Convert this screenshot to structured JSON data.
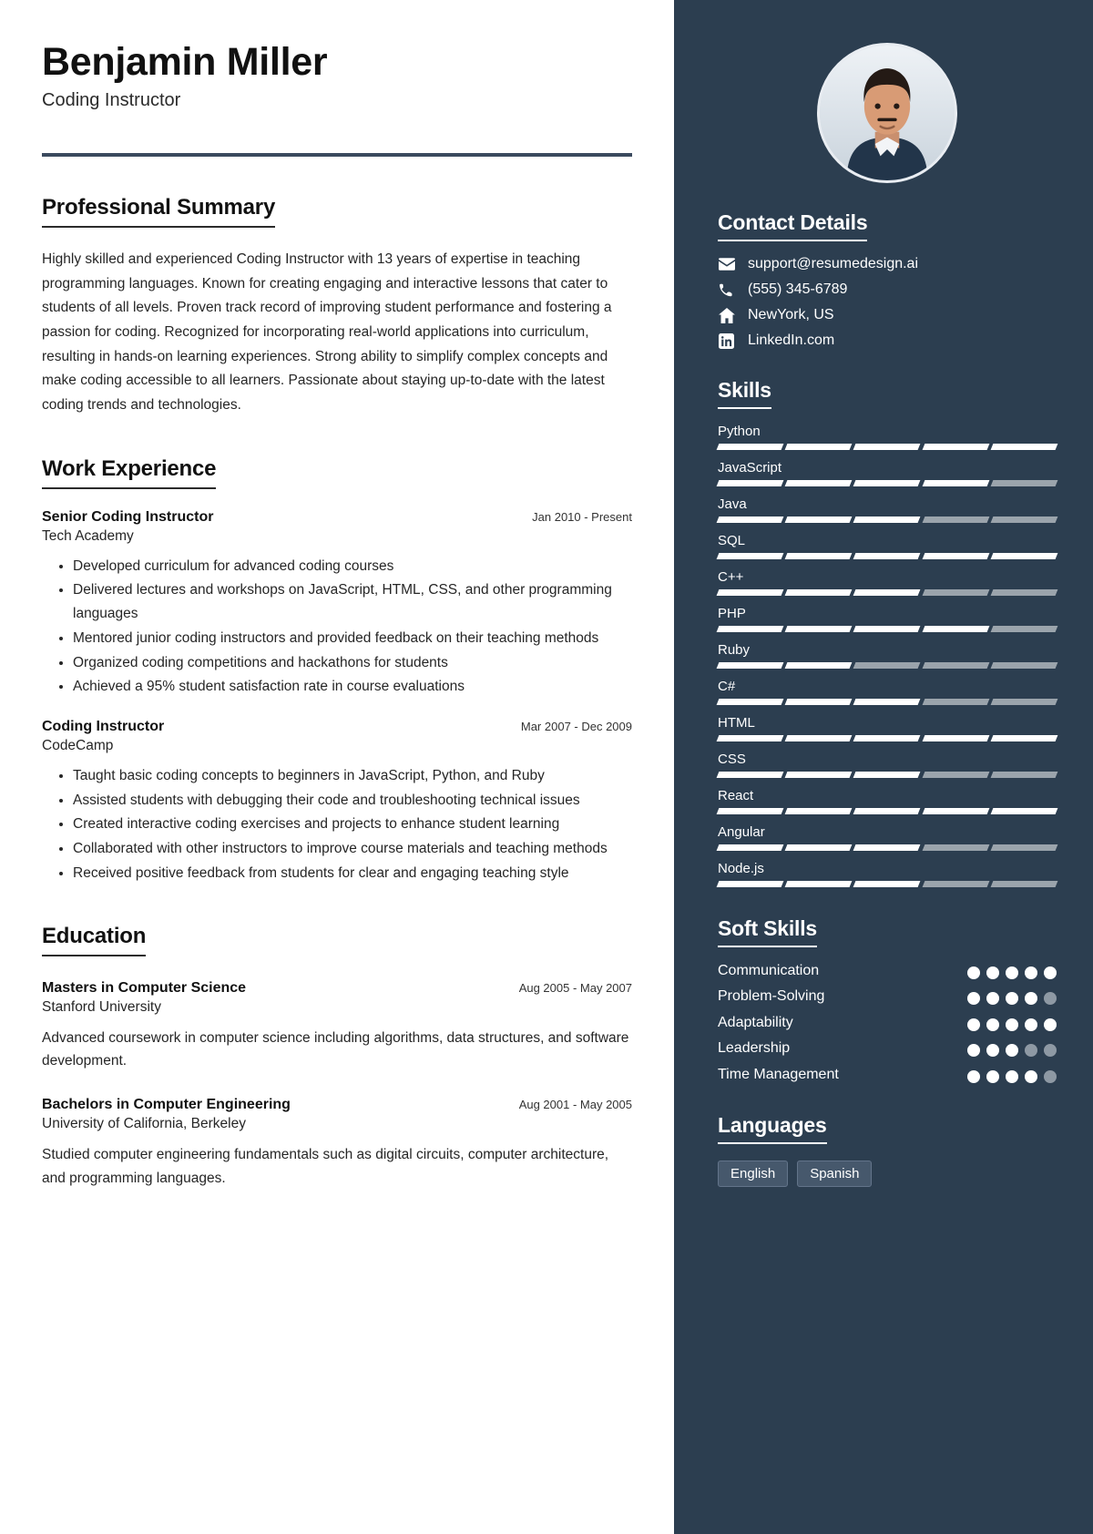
{
  "header": {
    "name": "Benjamin Miller",
    "job_title": "Coding Instructor"
  },
  "summary": {
    "title": "Professional Summary",
    "text": "Highly skilled and experienced Coding Instructor with 13 years of expertise in teaching programming languages. Known for creating engaging and interactive lessons that cater to students of all levels. Proven track record of improving student performance and fostering a passion for coding. Recognized for incorporating real-world applications into curriculum, resulting in hands-on learning experiences. Strong ability to simplify complex concepts and make coding accessible to all learners. Passionate about staying up-to-date with the latest coding trends and technologies."
  },
  "work": {
    "title": "Work Experience",
    "entries": [
      {
        "role": "Senior Coding Instructor",
        "date": "Jan 2010 - Present",
        "org": "Tech Academy",
        "bullets": [
          "Developed curriculum for advanced coding courses",
          "Delivered lectures and workshops on JavaScript, HTML, CSS, and other programming languages",
          "Mentored junior coding instructors and provided feedback on their teaching methods",
          "Organized coding competitions and hackathons for students",
          "Achieved a 95% student satisfaction rate in course evaluations"
        ]
      },
      {
        "role": "Coding Instructor",
        "date": "Mar 2007 - Dec 2009",
        "org": "CodeCamp",
        "bullets": [
          "Taught basic coding concepts to beginners in JavaScript, Python, and Ruby",
          "Assisted students with debugging their code and troubleshooting technical issues",
          "Created interactive coding exercises and projects to enhance student learning",
          "Collaborated with other instructors to improve course materials and teaching methods",
          "Received positive feedback from students for clear and engaging teaching style"
        ]
      }
    ]
  },
  "education": {
    "title": "Education",
    "entries": [
      {
        "degree": "Masters in Computer Science",
        "date": "Aug 2005 - May 2007",
        "school": "Stanford University",
        "description": "Advanced coursework in computer science including algorithms, data structures, and software development."
      },
      {
        "degree": "Bachelors in Computer Engineering",
        "date": "Aug 2001 - May 2005",
        "school": "University of California, Berkeley",
        "description": "Studied computer engineering fundamentals such as digital circuits, computer architecture, and programming languages."
      }
    ]
  },
  "contact": {
    "title": "Contact Details",
    "items": [
      {
        "icon": "envelope-icon",
        "value": "support@resumedesign.ai"
      },
      {
        "icon": "phone-icon",
        "value": "(555) 345-6789"
      },
      {
        "icon": "home-icon",
        "value": "NewYork, US"
      },
      {
        "icon": "linkedin-icon",
        "value": "LinkedIn.com"
      }
    ]
  },
  "skills": {
    "title": "Skills",
    "segments_total": 5,
    "items": [
      {
        "name": "Python",
        "filled": 5
      },
      {
        "name": "JavaScript",
        "filled": 4
      },
      {
        "name": "Java",
        "filled": 3
      },
      {
        "name": "SQL",
        "filled": 5
      },
      {
        "name": "C++",
        "filled": 3
      },
      {
        "name": "PHP",
        "filled": 4
      },
      {
        "name": "Ruby",
        "filled": 2
      },
      {
        "name": "C#",
        "filled": 3
      },
      {
        "name": "HTML",
        "filled": 5
      },
      {
        "name": "CSS",
        "filled": 3
      },
      {
        "name": "React",
        "filled": 5
      },
      {
        "name": "Angular",
        "filled": 3
      },
      {
        "name": "Node.js",
        "filled": 3
      }
    ]
  },
  "soft_skills": {
    "title": "Soft Skills",
    "dots_total": 5,
    "items": [
      {
        "name": "Communication",
        "filled": 5
      },
      {
        "name": "Problem-Solving",
        "filled": 4
      },
      {
        "name": "Adaptability",
        "filled": 5
      },
      {
        "name": "Leadership",
        "filled": 3
      },
      {
        "name": "Time Management",
        "filled": 4
      }
    ]
  },
  "languages": {
    "title": "Languages",
    "items": [
      "English",
      "Spanish"
    ]
  },
  "colors": {
    "sidebar_bg": "#2c3e50",
    "rule": "#3b4a5e",
    "segment_on": "#ffffff",
    "segment_off": "#9ba4ac"
  }
}
